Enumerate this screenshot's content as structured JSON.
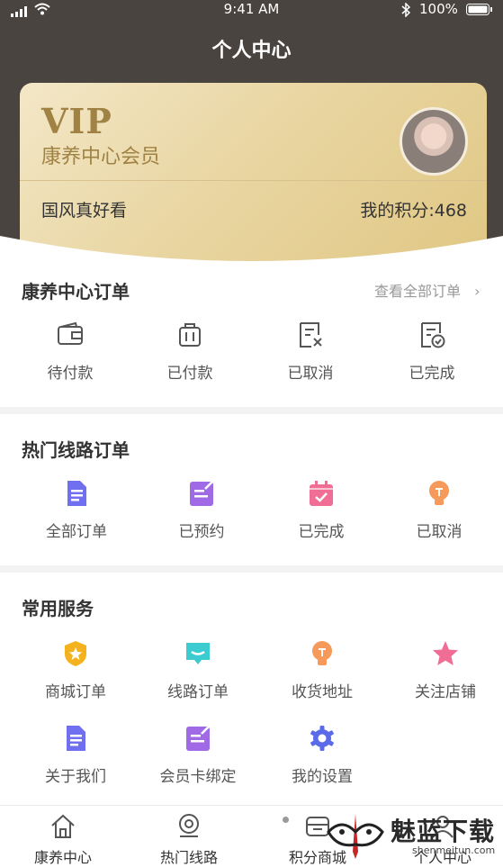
{
  "status_bar": {
    "time": "9:41 AM",
    "battery": "100%"
  },
  "header": {
    "title": "个人中心"
  },
  "vip_card": {
    "badge": "VIP",
    "subtitle": "康养中心会员",
    "user_name": "国风真好看",
    "points_label": "我的积分:468"
  },
  "orders": {
    "title": "康养中心订单",
    "view_all": "查看全部订单",
    "items": [
      {
        "label": "待付款",
        "icon": "wallet-icon"
      },
      {
        "label": "已付款",
        "icon": "luggage-icon"
      },
      {
        "label": "已取消",
        "icon": "cancelled-receipt-icon"
      },
      {
        "label": "已完成",
        "icon": "completed-receipt-icon"
      }
    ]
  },
  "routes": {
    "title": "热门线路订单",
    "items": [
      {
        "label": "全部订单",
        "icon": "document-icon",
        "color": "#6f6ff0"
      },
      {
        "label": "已预约",
        "icon": "edit-note-icon",
        "color": "#a069e6"
      },
      {
        "label": "已完成",
        "icon": "calendar-check-icon",
        "color": "#f06e96"
      },
      {
        "label": "已取消",
        "icon": "lightbulb-icon",
        "color": "#f59a5a"
      }
    ]
  },
  "services": {
    "title": "常用服务",
    "items": [
      {
        "label": "商城订单",
        "icon": "shield-star-icon",
        "color": "#f3b21e"
      },
      {
        "label": "线路订单",
        "icon": "message-icon",
        "color": "#3ccbd0"
      },
      {
        "label": "收货地址",
        "icon": "lightbulb-icon",
        "color": "#f59a5a"
      },
      {
        "label": "关注店铺",
        "icon": "star-icon",
        "color": "#f06e96"
      },
      {
        "label": "关于我们",
        "icon": "document-icon",
        "color": "#6f6ff0"
      },
      {
        "label": "会员卡绑定",
        "icon": "edit-note-icon",
        "color": "#a069e6"
      },
      {
        "label": "我的设置",
        "icon": "gear-icon",
        "color": "#5a6ae8"
      }
    ]
  },
  "tabbar": {
    "items": [
      {
        "label": "康养中心",
        "icon": "home-icon",
        "active": true
      },
      {
        "label": "热门线路",
        "icon": "location-icon",
        "active": false
      },
      {
        "label": "积分商城",
        "icon": "store-icon",
        "active": false
      },
      {
        "label": "个人中心",
        "icon": "user-icon",
        "active": false
      }
    ]
  },
  "watermark": {
    "text": "魅蓝下载",
    "subtext": "shenmeitun.com"
  }
}
